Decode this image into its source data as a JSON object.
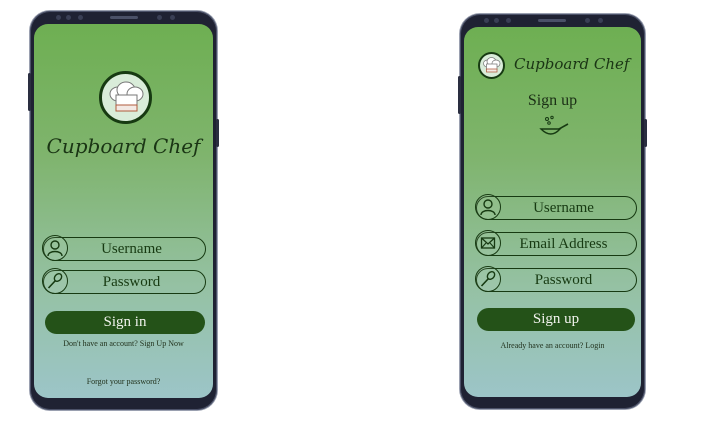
{
  "colors": {
    "gradient_top": "#6eaf52",
    "gradient_bottom": "#9cc5c8",
    "primary_button": "#245218",
    "outline": "#173a12"
  },
  "login": {
    "brand": "Cupboard Chef",
    "username": "Username",
    "password": "Password",
    "sign_in": "Sign in",
    "signup_prompt": "Don't have an account? Sign Up Now",
    "forgot": "Forgot your password?"
  },
  "signup": {
    "brand": "Cupboard Chef",
    "title": "Sign up",
    "username": "Username",
    "email": "Email Address",
    "password": "Password",
    "sign_up": "Sign up",
    "login_prompt": "Already have an account? Login"
  },
  "icons": [
    "chef-hat-icon",
    "user-icon",
    "spoon-icon",
    "mail-icon",
    "frying-pan-icon"
  ]
}
